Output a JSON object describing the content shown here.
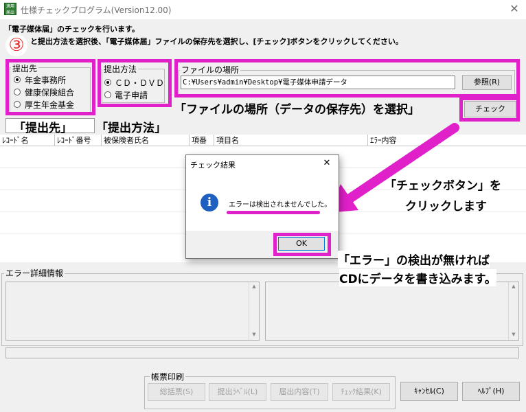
{
  "window": {
    "title": "仕様チェックプログラム(Version12.00)",
    "icon_text": "適用\n届出",
    "close": "✕"
  },
  "instructions": {
    "line1": "「電子媒体届」のチェックを行います。",
    "line2": "と提出方法を選択後、「電子媒体届」ファイルの保存先を選択し、[チェック]ボタンをクリックしてください。"
  },
  "step_marker": "③",
  "submit_to": {
    "legend": "提出先",
    "options": [
      "年金事務所",
      "健康保険組合",
      "厚生年金基金"
    ],
    "selected": 0
  },
  "method": {
    "legend": "提出方法",
    "options": [
      "ＣＤ・ＤＶＤ",
      "電子申請"
    ],
    "selected": 0
  },
  "file": {
    "legend": "ファイルの場所",
    "path": "C:¥Users¥admin¥Desktop¥電子媒体申請データ",
    "browse_label": "参照(R)"
  },
  "check_button": "チェック",
  "table_headers": [
    "ﾚｺｰﾄﾞ名",
    "ﾚｺｰﾄﾞ番号",
    "被保険者氏名",
    "項番",
    "項目名",
    "ｴﾗｰ内容"
  ],
  "error_detail": {
    "legend": "エラー詳細情報"
  },
  "print_group": {
    "legend": "帳票印刷",
    "buttons": [
      "総括票(S)",
      "提出ﾗﾍﾞﾙ(L)",
      "届出内容(T)",
      "ﾁｪｯｸ結果(K)"
    ]
  },
  "footer_buttons": {
    "cancel": "ｷｬﾝｾﾙ(C)",
    "help": "ﾍﾙﾌﾟ(H)"
  },
  "dialog": {
    "title": "チェック結果",
    "message": "エラーは検出されませんでした。",
    "ok": "OK",
    "close": "✕",
    "icon_glyph": "i"
  },
  "annotations": {
    "file_location": "「ファイルの場所（データの保存先）を選択」",
    "submit_to": "「提出先」",
    "method": "「提出方法」",
    "click_line1": "「チェックボタン」を",
    "click_line2": "クリックします",
    "result_line1": "「エラー」の検出が無ければ",
    "result_line2": "CDにデータを書き込みます。"
  },
  "colors": {
    "highlight": "#e020c8",
    "accent_icon": "#1e5fbf"
  }
}
